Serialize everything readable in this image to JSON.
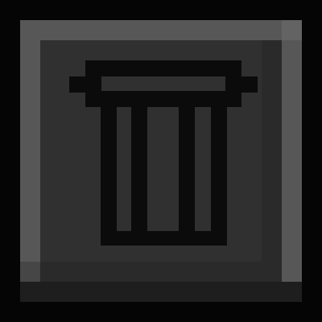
{
  "button": {
    "icon": "trash-icon",
    "colors": {
      "outer_frame": "#050505",
      "bevel_light": "#575757",
      "bevel_lighter": "#636363",
      "bevel_dark": "#2a2a2a",
      "bevel_darker": "#1e1e1e",
      "face": "#303030",
      "icon": "#0b0b0b"
    }
  }
}
